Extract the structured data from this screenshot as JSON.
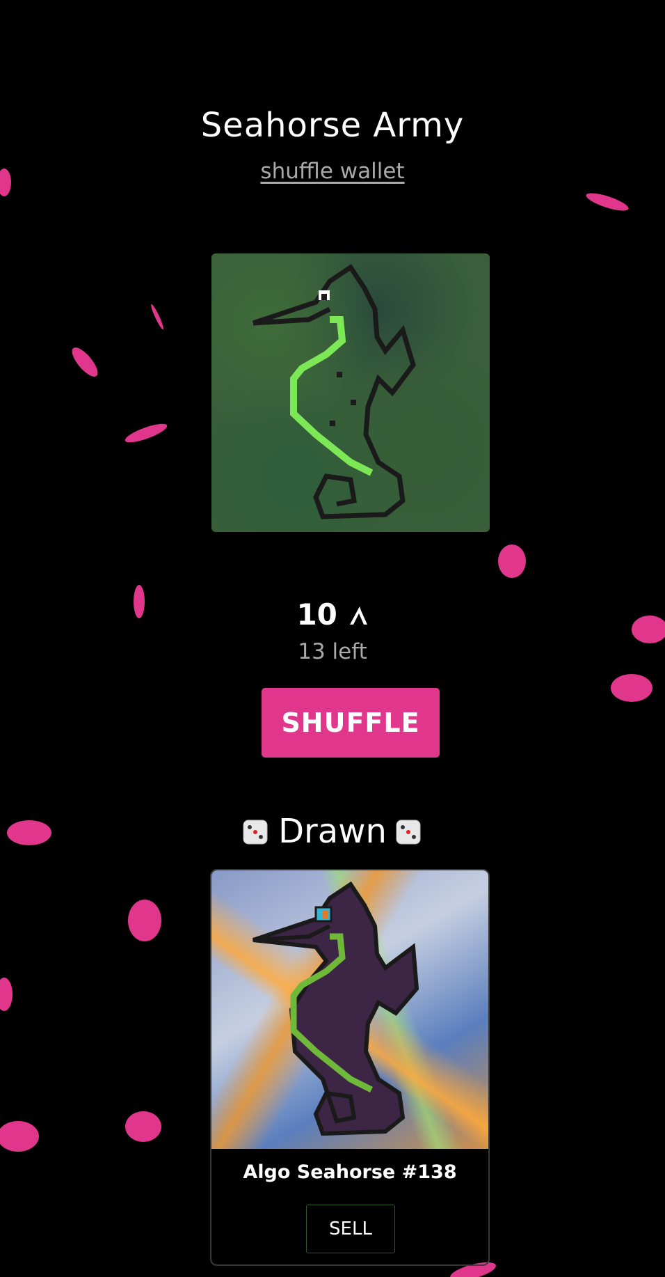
{
  "header": {
    "title": "Seahorse Army",
    "wallet_link": "shuffle wallet"
  },
  "shuffle": {
    "price": "10",
    "currency_icon": "algorand-icon",
    "remaining": "13 left",
    "button_label": "SHUFFLE"
  },
  "drawn": {
    "title": "Drawn",
    "dice_icon": "dice-icon",
    "item_name": "Algo Seahorse #138",
    "sell_label": "SELL"
  },
  "colors": {
    "accent": "#e0368c",
    "background": "#000000",
    "muted_text": "#a9a9a9"
  }
}
